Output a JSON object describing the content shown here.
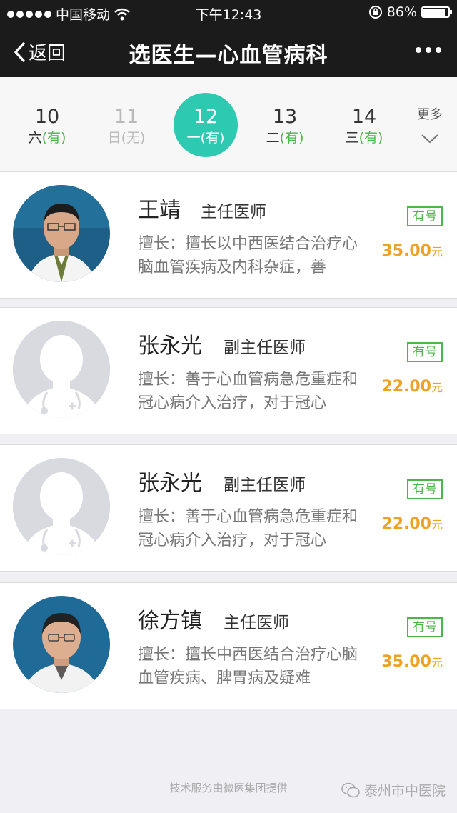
{
  "status_bar": {
    "carrier": "中国移动",
    "time": "下午12:43",
    "battery": "86%",
    "battery_level": 0.86,
    "icons": [
      "signal-dots-icon",
      "wifi-icon",
      "rotation-lock-icon",
      "battery-icon"
    ]
  },
  "nav": {
    "back_label": "返回",
    "title": "选医生—心血管病科",
    "more_icon": "more-dots-icon"
  },
  "dates": [
    {
      "day": "10",
      "weekday": "六",
      "status": "(有)",
      "available": true,
      "selected": false
    },
    {
      "day": "11",
      "weekday": "日",
      "status": "(无)",
      "available": false,
      "selected": false
    },
    {
      "day": "12",
      "weekday": "一",
      "status": "(有)",
      "available": true,
      "selected": true
    },
    {
      "day": "13",
      "weekday": "二",
      "status": "(有)",
      "available": true,
      "selected": false
    },
    {
      "day": "14",
      "weekday": "三",
      "status": "(有)",
      "available": true,
      "selected": false
    }
  ],
  "date_more_label": "更多",
  "colors": {
    "accent": "#2ec9b1",
    "available_green": "#4cb648",
    "price_orange": "#f0a023",
    "nav_bg": "#1b1b1b"
  },
  "doctors": [
    {
      "name": "王靖",
      "title": "主任医师",
      "specialty": "擅长：擅长以中西医结合治疗心脑血管疾病及内科杂症，善",
      "badge": "有号",
      "price": "35.00",
      "unit": "元",
      "avatar": "photo"
    },
    {
      "name": "张永光",
      "title": "副主任医师",
      "specialty": "擅长：善于心血管病急危重症和冠心病介入治疗，对于冠心",
      "badge": "有号",
      "price": "22.00",
      "unit": "元",
      "avatar": "placeholder"
    },
    {
      "name": "张永光",
      "title": "副主任医师",
      "specialty": "擅长：善于心血管病急危重症和冠心病介入治疗，对于冠心",
      "badge": "有号",
      "price": "22.00",
      "unit": "元",
      "avatar": "placeholder"
    },
    {
      "name": "徐方镇",
      "title": "主任医师",
      "specialty": "擅长：擅长中西医结合治疗心脑血管疾病、脾胃病及疑难",
      "badge": "有号",
      "price": "35.00",
      "unit": "元",
      "avatar": "photo"
    }
  ],
  "footer": {
    "service_text": "技术服务由微医集团提供",
    "watermark": "泰州市中医院"
  }
}
